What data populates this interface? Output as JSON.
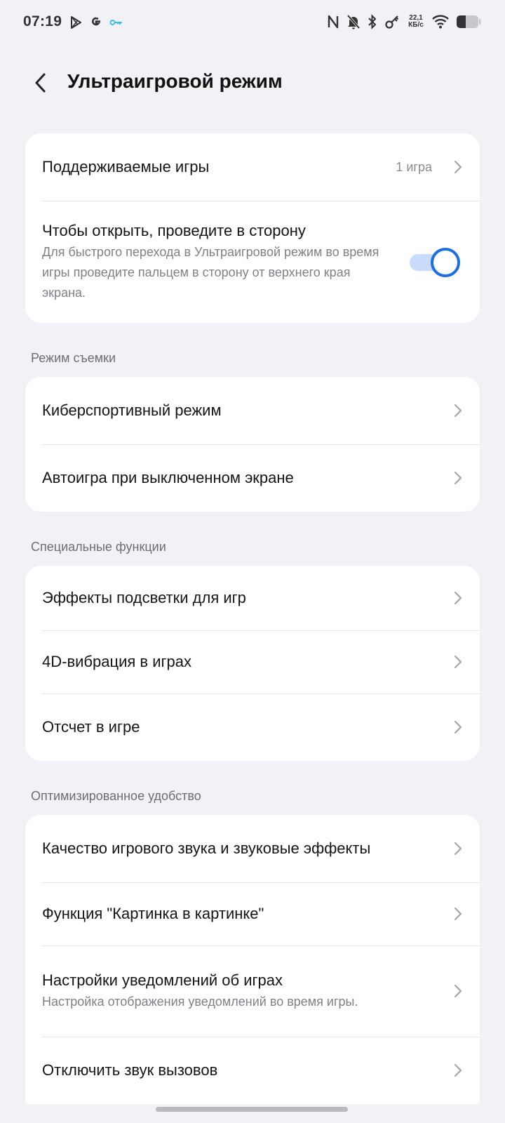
{
  "status_bar": {
    "time": "07:19",
    "speed_value": "22,1",
    "speed_unit": "КБ/с",
    "icons_left": [
      "play-store-icon",
      "google-icon",
      "key-icon"
    ],
    "icons_right": [
      "nfc-icon",
      "bell-off-icon",
      "bluetooth-icon",
      "key-link-icon",
      "wifi-icon",
      "battery-icon"
    ]
  },
  "header": {
    "title": "Ультраигровой режим"
  },
  "card_main": {
    "supported_games_label": "Поддерживаемые игры",
    "supported_games_value": "1 игра",
    "swipe_title": "Чтобы открыть, проведите в сторону",
    "swipe_sub": "Для быстрого перехода в Ультраигровой режим во время игры проведите пальцем в сторону от верхнего края экрана.",
    "swipe_toggle_on": true
  },
  "section_shooting": {
    "label": "Режим съемки",
    "items": [
      "Киберспортивный режим",
      "Автоигра при выключенном экране"
    ]
  },
  "section_special": {
    "label": "Специальные функции",
    "items": [
      "Эффекты подсветки для игр",
      "4D-вибрация в играх",
      "Отсчет в игре"
    ]
  },
  "section_optimized": {
    "label": "Оптимизированное удобство",
    "items": [
      "Качество игрового звука и звуковые эффекты",
      "Функция \"Картинка в картинке\"",
      "Настройки уведомлений об играх",
      "Отключить звук вызовов"
    ],
    "notif_sub": "Настройка отображения уведомлений во время игры."
  },
  "colors": {
    "background": "#f1f1f6",
    "card": "#ffffff",
    "accent": "#1b6fe6",
    "toggle_track": "#c9dcfb"
  }
}
